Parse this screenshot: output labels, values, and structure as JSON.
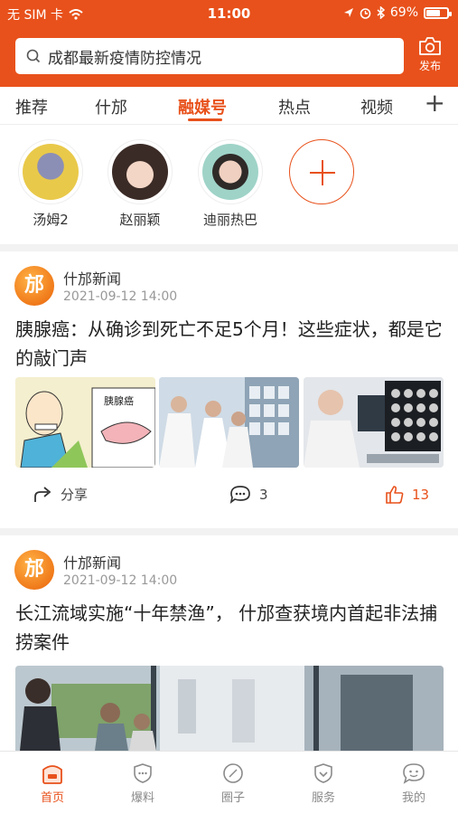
{
  "status_bar": {
    "carrier": "无 SIM 卡",
    "time": "11:00",
    "battery": "69%",
    "battery_level": 0.69
  },
  "search": {
    "text": "成都最新疫情防控情况"
  },
  "publish": {
    "label": "发布"
  },
  "tabs": [
    {
      "label": "推荐"
    },
    {
      "label": "什邡"
    },
    {
      "label": "融媒号"
    },
    {
      "label": "热点"
    },
    {
      "label": "视频"
    }
  ],
  "follows": [
    {
      "name": "汤姆2"
    },
    {
      "name": "赵丽颖"
    },
    {
      "name": "迪丽热巴"
    }
  ],
  "articles": [
    {
      "source": "什邡新闻",
      "logo_char": "邡",
      "time": "2021-09-12  14:00",
      "title": "胰腺癌：从确诊到死亡不足5个月！这些症状，都是它的敲门声",
      "image_caption": "胰腺癌",
      "share_label": "分享",
      "comment_count": "3",
      "like_count": "13"
    },
    {
      "source": "什邡新闻",
      "logo_char": "邡",
      "time": "2021-09-12  14:00",
      "title": "长江流域实施“十年禁渔”， 什邡查获境内首起非法捕捞案件"
    }
  ],
  "bottom_nav": [
    {
      "label": "首页"
    },
    {
      "label": "爆料"
    },
    {
      "label": "圈子"
    },
    {
      "label": "服务"
    },
    {
      "label": "我的"
    }
  ],
  "colors": {
    "accent": "#e8511b",
    "muted": "#8a8a8a"
  }
}
